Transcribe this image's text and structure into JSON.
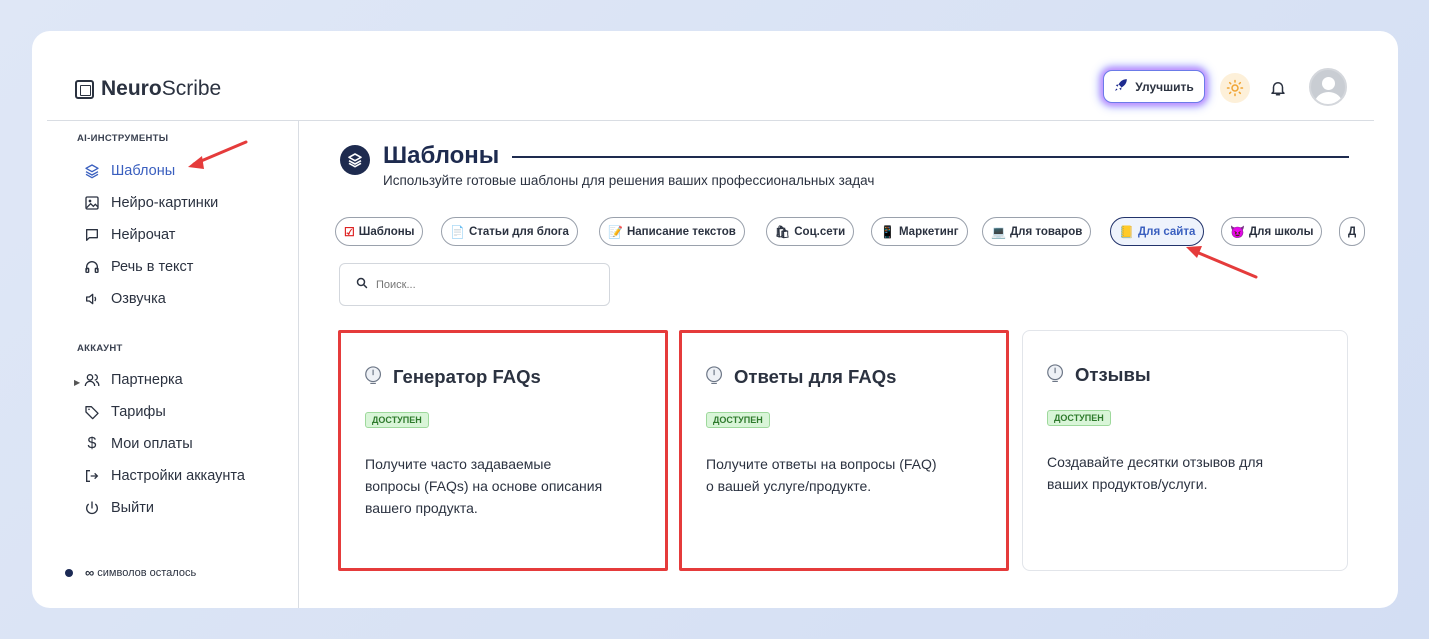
{
  "brand": {
    "bold": "Neuro",
    "rest": "Scribe"
  },
  "topbar": {
    "upgrade_label": "Улучшить"
  },
  "sidebar": {
    "ai_section": "AI-ИНСТРУМЕНТЫ",
    "ai_items": [
      {
        "label": "Шаблоны",
        "icon": "layers-icon",
        "active": true
      },
      {
        "label": "Нейро-картинки",
        "icon": "image-icon"
      },
      {
        "label": "Нейрочат",
        "icon": "chat-icon"
      },
      {
        "label": "Речь в текст",
        "icon": "headphones-icon"
      },
      {
        "label": "Озвучка",
        "icon": "speaker-icon"
      }
    ],
    "account_section": "АККАУНТ",
    "account_items": [
      {
        "label": "Партнерка",
        "icon": "users-icon"
      },
      {
        "label": "Тарифы",
        "icon": "tag-icon"
      },
      {
        "label": "Мои оплаты",
        "icon": "dollar-icon"
      },
      {
        "label": "Настройки аккаунта",
        "icon": "logout-arrow-icon"
      },
      {
        "label": "Выйти",
        "icon": "power-icon"
      }
    ],
    "remaining_symbol": "∞",
    "remaining_label": "символов осталось"
  },
  "main": {
    "title": "Шаблоны",
    "subtitle": "Используйте готовые шаблоны для решения ваших профессиональных задач",
    "search_placeholder": "Поиск...",
    "chips": [
      {
        "emoji": "☑",
        "label": "Шаблоны"
      },
      {
        "emoji": "📄",
        "label": "Статьи для блога"
      },
      {
        "emoji": "📝",
        "label": "Написание текстов"
      },
      {
        "emoji": "🛍",
        "label": "Соц.сети"
      },
      {
        "emoji": "📱",
        "label": "Маркетинг"
      },
      {
        "emoji": "💻",
        "label": "Для товаров"
      },
      {
        "emoji": "📒",
        "label": "Для сайта",
        "selected": true
      },
      {
        "emoji": "😈",
        "label": "Для школы"
      },
      {
        "emoji": "",
        "label": "Д"
      }
    ],
    "cards": [
      {
        "title": "Генератор FAQs",
        "badge": "ДОСТУПЕН",
        "desc": [
          "Получите часто задаваемые",
          "вопросы (FAQs) на основе описания",
          "вашего продукта."
        ],
        "highlighted": true
      },
      {
        "title": "Ответы для FAQs",
        "badge": "ДОСТУПЕН",
        "desc": [
          "Получите ответы на вопросы (FAQ)",
          "о вашей услуге/продукте."
        ],
        "highlighted": true
      },
      {
        "title": "Отзывы",
        "badge": "ДОСТУПЕН",
        "desc": [
          "Создавайте десятки отзывов для",
          "ваших продуктов/услуги."
        ],
        "highlighted": false
      }
    ]
  },
  "colors": {
    "accent": "#3a5fbf",
    "annotation": "#e53b3b",
    "dark": "#1e2b4f"
  }
}
